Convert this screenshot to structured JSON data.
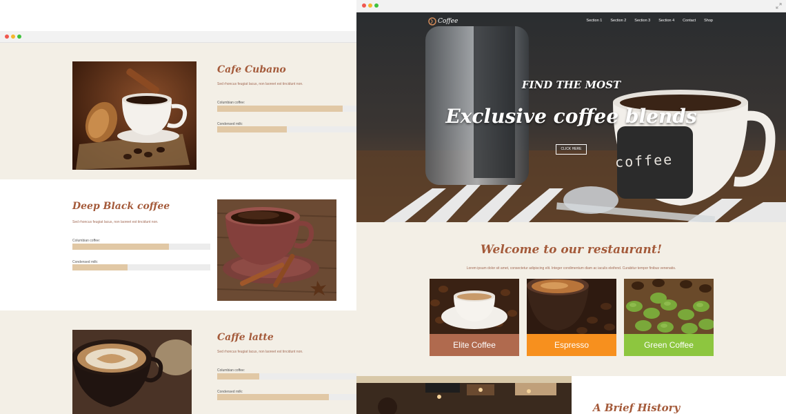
{
  "left_window": {
    "products": [
      {
        "title": "Cafe Cubano",
        "description": "Sed rhoncus feugiat lacus, non laoreet est tincidunt non.",
        "bars": [
          {
            "label": "Columbian coffee:",
            "percent": 90
          },
          {
            "label": "Condensed milk:",
            "percent": 50
          }
        ]
      },
      {
        "title": "Deep Black coffee",
        "description": "Sed rhoncus feugiat lacus, non laoreet est tincidunt non.",
        "bars": [
          {
            "label": "Columbian coffee:",
            "percent": 70
          },
          {
            "label": "Condensed milk:",
            "percent": 40
          }
        ]
      },
      {
        "title": "Caffe latte",
        "description": "Sed rhoncus feugiat lacus, non laoreet est tincidunt non.",
        "bars": [
          {
            "label": "Columbian coffee:",
            "percent": 30
          },
          {
            "label": "Condensed milk:",
            "percent": 80
          }
        ]
      }
    ]
  },
  "right_window": {
    "logo_text": "Coffee",
    "nav": [
      "Section 1",
      "Section 2",
      "Section 3",
      "Section 4",
      "Contact",
      "Shop"
    ],
    "hero": {
      "kicker": "FIND THE MOST",
      "title": "Exclusive coffee blends",
      "button": "CLICK HERE",
      "cup_text": "coffee"
    },
    "welcome": {
      "title": "Welcome to our restaurant!",
      "text": "Lorem ipsum dolor sit amet, consectetur adipiscing elit. Integer condimentum diam ac iaculis eleifend. Curabitur tempor finibus venenatis."
    },
    "cards": [
      {
        "label": "Elite Coffee",
        "color": "#b06a4e"
      },
      {
        "label": "Espresso",
        "color": "#f7901e"
      },
      {
        "label": "Green Coffee",
        "color": "#8dc63f"
      }
    ],
    "history_title": "A Brief History"
  },
  "colors": {
    "accent": "#a45a3a",
    "cream": "#f3efe6",
    "bar_fill": "#e1c8a5",
    "bar_track": "#ececec"
  }
}
